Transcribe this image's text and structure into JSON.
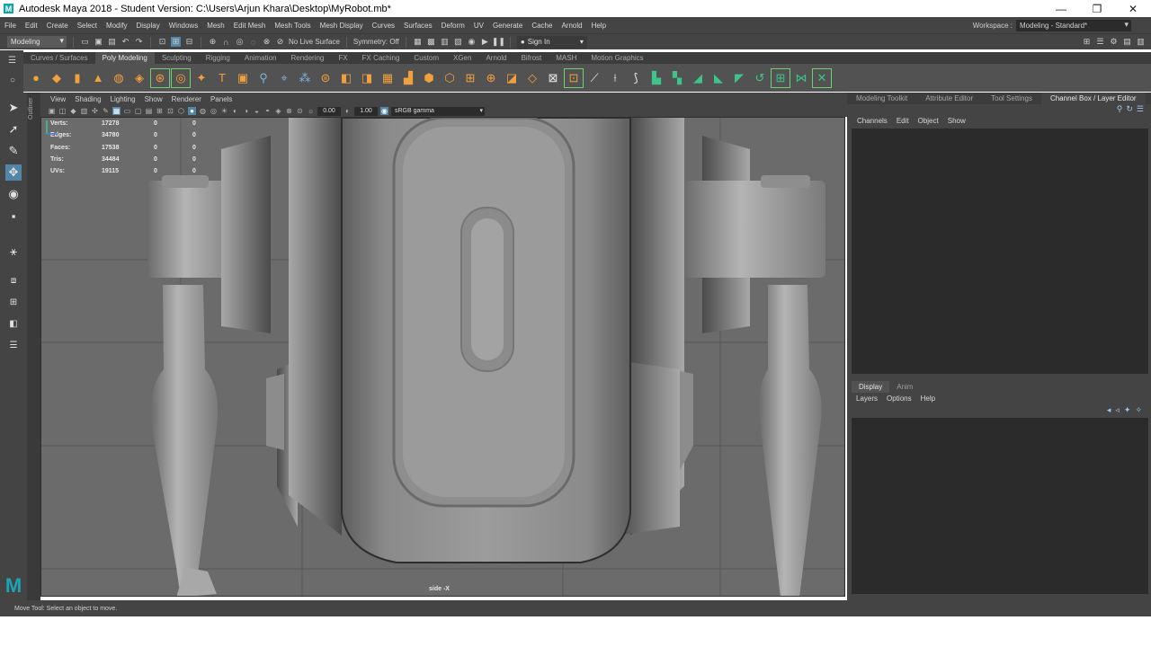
{
  "window": {
    "title": "Autodesk Maya 2018 - Student Version: C:\\Users\\Arjun Khara\\Desktop\\MyRobot.mb*",
    "minimize": "—",
    "maximize": "❐",
    "close": "✕"
  },
  "menubar": {
    "items": [
      "File",
      "Edit",
      "Create",
      "Select",
      "Modify",
      "Display",
      "Windows",
      "Mesh",
      "Edit Mesh",
      "Mesh Tools",
      "Mesh Display",
      "Curves",
      "Surfaces",
      "Deform",
      "UV",
      "Generate",
      "Cache",
      "Arnold",
      "Help"
    ],
    "workspace_label": "Workspace :",
    "workspace_value": "Modeling - Standard*"
  },
  "statusline": {
    "mode": "Modeling",
    "live_surface": "No Live Surface",
    "symmetry": "Symmetry: Off",
    "sign_in": "Sign In"
  },
  "shelf": {
    "tabs": [
      "Curves / Surfaces",
      "Poly Modeling",
      "Sculpting",
      "Rigging",
      "Animation",
      "Rendering",
      "FX",
      "FX Caching",
      "Custom",
      "XGen",
      "Arnold",
      "Bifrost",
      "MASH",
      "Motion Graphics"
    ],
    "active_tab": "Poly Modeling"
  },
  "viewport": {
    "menu": [
      "View",
      "Shading",
      "Lighting",
      "Show",
      "Renderer",
      "Panels"
    ],
    "near_value": "0.00",
    "far_value": "1.00",
    "color_space": "sRGB gamma",
    "camera": "side -X",
    "hud": [
      {
        "label": "Verts:",
        "v1": "17278",
        "v2": "0",
        "v3": "0"
      },
      {
        "label": "Edges:",
        "v1": "34780",
        "v2": "0",
        "v3": "0"
      },
      {
        "label": "Faces:",
        "v1": "17538",
        "v2": "0",
        "v3": "0"
      },
      {
        "label": "Tris:",
        "v1": "34484",
        "v2": "0",
        "v3": "0"
      },
      {
        "label": "UVs:",
        "v1": "19115",
        "v2": "0",
        "v3": "0"
      }
    ]
  },
  "outliner": {
    "label": "Outliner"
  },
  "right_panel": {
    "tabs": [
      "Modeling Toolkit",
      "Attribute Editor",
      "Tool Settings",
      "Channel Box / Layer Editor"
    ],
    "active_tab": "Channel Box / Layer Editor",
    "channel_menu": [
      "Channels",
      "Edit",
      "Object",
      "Show"
    ],
    "layer_tabs": [
      "Display",
      "Anim"
    ],
    "layer_menu": [
      "Layers",
      "Options",
      "Help"
    ]
  },
  "helpline": {
    "text": "Move Tool: Select an object to move."
  },
  "colors": {
    "ui_dark": "#444444",
    "field": "#2b2b2b",
    "accent": "#5285a6",
    "shelf_orange": "#f0a03c",
    "shelf_green": "#3ec48a",
    "maya_teal": "#1aa5b5"
  }
}
